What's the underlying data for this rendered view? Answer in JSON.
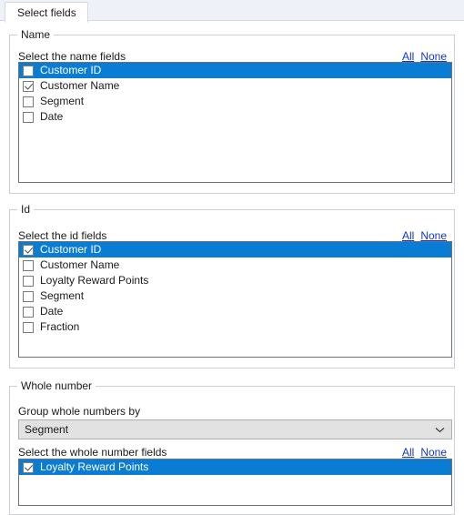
{
  "window": {
    "title": "Select fields"
  },
  "tabs": [
    {
      "label": "Select fields",
      "active": true
    }
  ],
  "links": {
    "all": "All",
    "none": "None"
  },
  "colors": {
    "selection_blue": "#0a7cd4",
    "link_blue": "#1436d0",
    "listbox_border": "#6d7278",
    "groupbox_border": "#ccd0d6",
    "tabstrip_background": "#eef1f8",
    "combo_background": "#e2e2e2"
  },
  "groups": {
    "name": {
      "title": "Name",
      "caption": "Select the name fields",
      "items": [
        {
          "label": "Customer ID",
          "checked": false,
          "selected": true
        },
        {
          "label": "Customer Name",
          "checked": true,
          "selected": false
        },
        {
          "label": "Segment",
          "checked": false,
          "selected": false
        },
        {
          "label": "Date",
          "checked": false,
          "selected": false
        }
      ]
    },
    "id": {
      "title": "Id",
      "caption": "Select the id fields",
      "items": [
        {
          "label": "Customer ID",
          "checked": true,
          "selected": true
        },
        {
          "label": "Customer Name",
          "checked": false,
          "selected": false
        },
        {
          "label": "Loyalty Reward Points",
          "checked": false,
          "selected": false
        },
        {
          "label": "Segment",
          "checked": false,
          "selected": false
        },
        {
          "label": "Date",
          "checked": false,
          "selected": false
        },
        {
          "label": "Fraction",
          "checked": false,
          "selected": false
        }
      ]
    },
    "whole_number": {
      "title": "Whole number",
      "group_by_label": "Group whole numbers by",
      "group_by_value": "Segment",
      "caption": "Select the whole number fields",
      "items": [
        {
          "label": "Loyalty Reward Points",
          "checked": true,
          "selected": true
        }
      ]
    }
  }
}
